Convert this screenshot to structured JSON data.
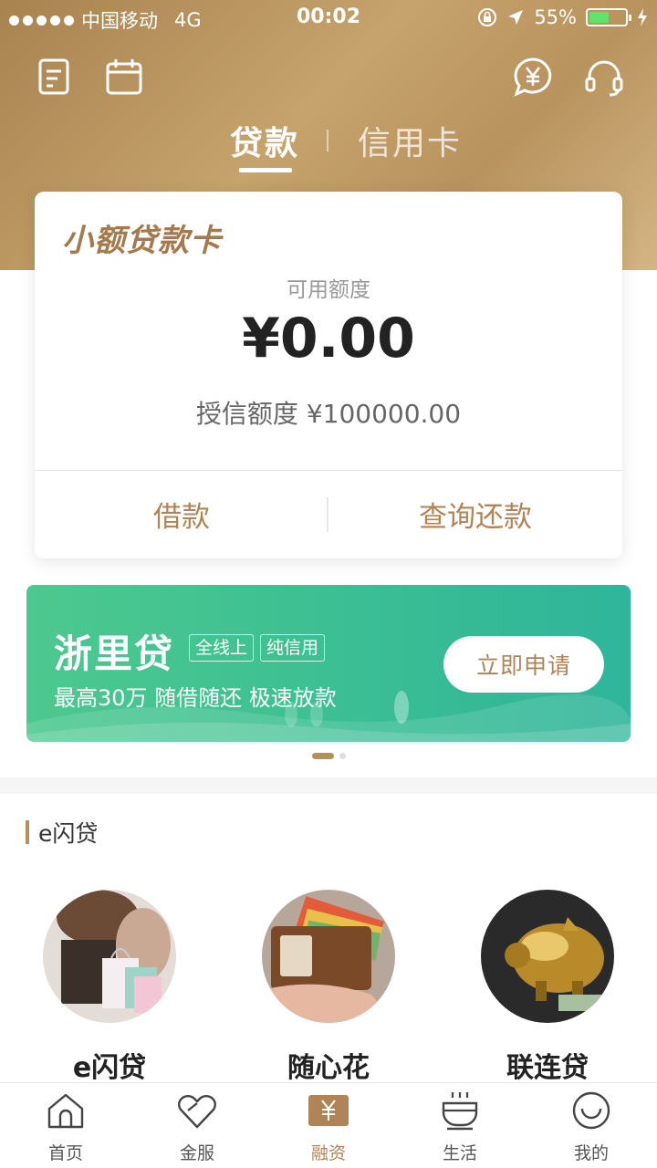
{
  "status_bar": {
    "carrier": "中国移动",
    "network": "4G",
    "time": "00:02",
    "battery": "55%",
    "battery_level": 0.55
  },
  "header": {
    "tabs": [
      {
        "label": "贷款",
        "active": true
      },
      {
        "label": "信用卡",
        "active": false
      }
    ],
    "icons": [
      "bill-icon",
      "calendar-icon",
      "yuan-chat-icon",
      "headset-icon"
    ]
  },
  "loan_card": {
    "title": "小额贷款卡",
    "available_label": "可用额度",
    "available_amount": "¥0.00",
    "credit_line": "授信额度 ¥100000.00",
    "actions": [
      "借款",
      "查询还款"
    ]
  },
  "banner": {
    "title": "浙里贷",
    "tags": [
      "全线上",
      "纯信用"
    ],
    "subtitle": "最高30万 随借随还 极速放款",
    "button": "立即申请",
    "color": "#3cbf93"
  },
  "section": {
    "title": "e闪贷",
    "products": [
      {
        "name": "e闪贷",
        "image": "shopping-woman-image"
      },
      {
        "name": "随心花",
        "image": "wallet-image"
      },
      {
        "name": "联连贷",
        "image": "gold-piggy-bank-image"
      }
    ]
  },
  "tabbar": {
    "items": [
      {
        "label": "首页",
        "icon": "home-icon"
      },
      {
        "label": "金服",
        "icon": "heart-icon"
      },
      {
        "label": "融资",
        "icon": "yuan-icon",
        "active": true
      },
      {
        "label": "生活",
        "icon": "cup-icon"
      },
      {
        "label": "我的",
        "icon": "smile-icon"
      }
    ],
    "accent": "#b08456"
  }
}
